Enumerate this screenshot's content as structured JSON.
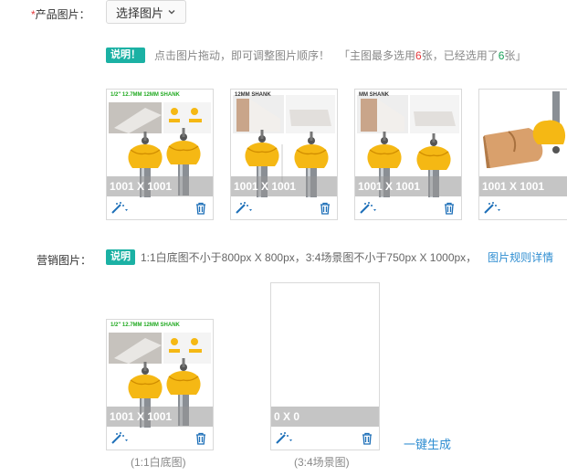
{
  "product_images": {
    "label": "产品图片：",
    "required_mark": "*",
    "select_button": "选择图片",
    "tag": "说明！",
    "hint": "点击图片拖动，即可调整图片顺序！",
    "quota_prefix": "「主图最多选用",
    "quota_max": "6",
    "quota_mid": "张，已经选用了",
    "quota_used": "6",
    "quota_suffix": "张」",
    "cards": [
      {
        "dimension": "1001 X 1001",
        "banner": "1/2\" 12.7MM 12MM SHANK"
      },
      {
        "dimension": "1001 X 1001",
        "banner": "12MM SHANK"
      },
      {
        "dimension": "1001 X 1001",
        "banner": "MM SHANK"
      },
      {
        "dimension": "1001 X 1001",
        "banner": ""
      }
    ]
  },
  "marketing_images": {
    "label": "营销图片：",
    "tag": "说明",
    "hint": "1:1白底图不小于800px X 800px，3:4场景图不小于750px X 1000px，",
    "rules_link": "图片规则详情",
    "cards": [
      {
        "dimension": "1001 X 1001",
        "caption": "(1:1白底图)",
        "banner": "1/2\" 12.7MM 12MM SHANK"
      },
      {
        "dimension": "0 X 0",
        "caption": "(3:4场景图)"
      }
    ],
    "generate_link": "一键生成"
  },
  "icons": {
    "edit": "magic-wand-icon",
    "delete": "trash-icon",
    "dropdown": "chevron-down-icon"
  },
  "colors": {
    "accent_tag": "#1bb1a4",
    "link": "#2e8dd1",
    "required": "#e4393c",
    "router_bit_yellow": "#f5b814",
    "overlay": "#9a9a9a"
  }
}
